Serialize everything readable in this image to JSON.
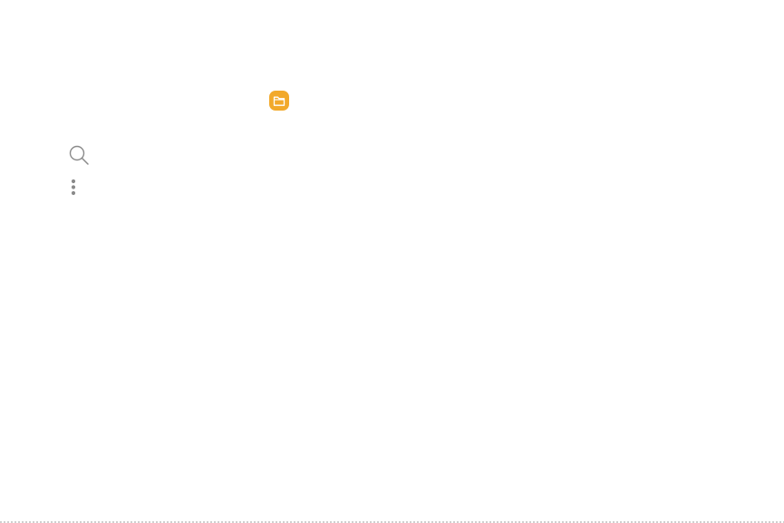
{
  "icons": {
    "my_files": {
      "name": "my-files-app-icon",
      "color": "#F2A92B",
      "glyph_color": "#FFFFFF"
    },
    "search": {
      "name": "search-icon",
      "color": "#8A8A8A"
    },
    "more_options": {
      "name": "more-options-icon",
      "color": "#8A8A8A"
    }
  },
  "background": "#FFFFFF"
}
